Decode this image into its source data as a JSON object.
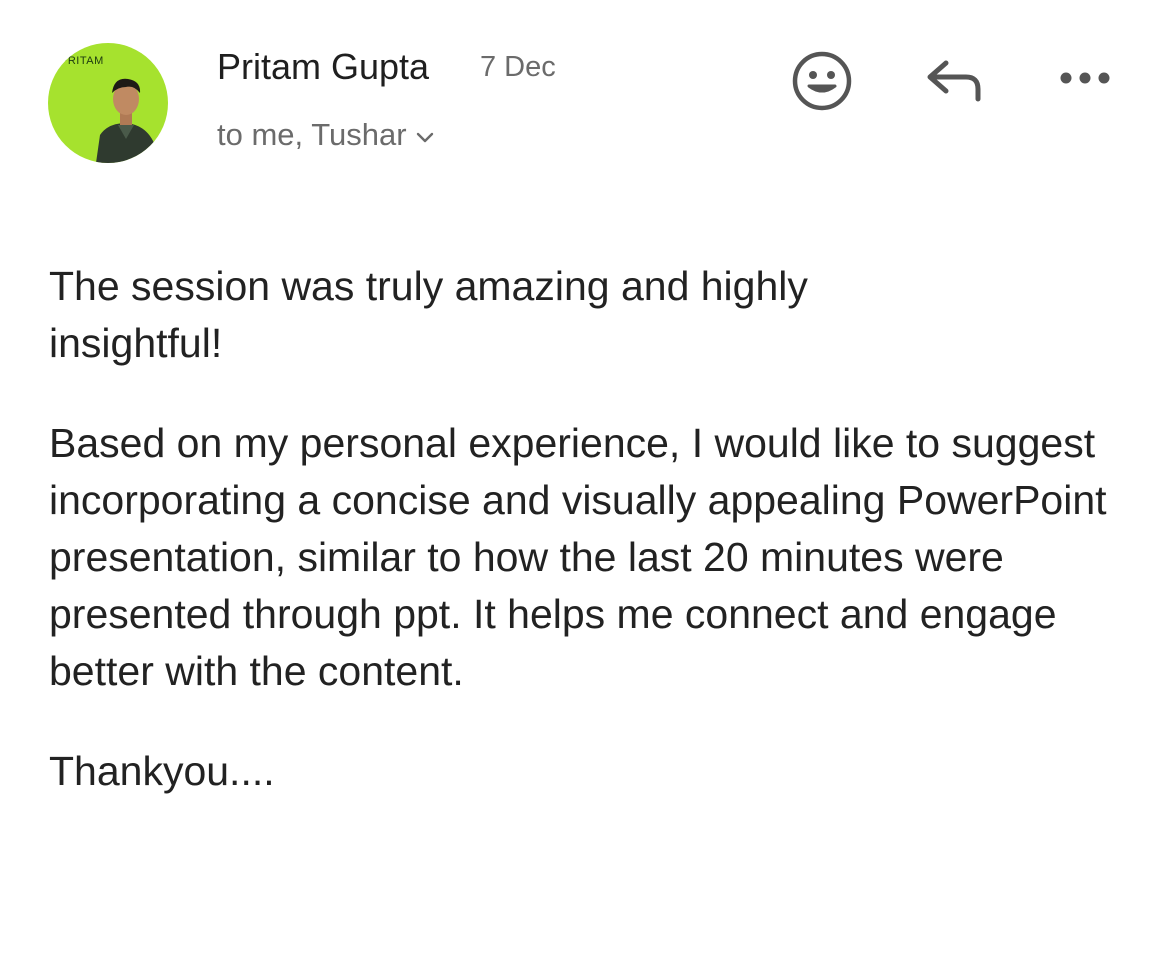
{
  "header": {
    "avatar_text": "PRITAM",
    "sender_name": "Pritam Gupta",
    "date": "7 Dec",
    "recipients": "to me, Tushar",
    "icons": {
      "emoji": "smiley-face-icon",
      "reply": "reply-arrow-icon",
      "more": "more-options-icon",
      "expand": "chevron-down-icon"
    }
  },
  "message": {
    "paragraphs": [
      "The session was truly amazing and highly insightful!",
      "Based on my personal experience, I would like to suggest incorporating a concise and visually appealing PowerPoint presentation, similar to how the last 20 minutes were presented through ppt. It helps me connect and engage better with the content.",
      "Thankyou...."
    ]
  },
  "colors": {
    "avatar_background": "#a6e22e",
    "icon_color": "#555555",
    "secondary_text": "#6b6b6b"
  }
}
